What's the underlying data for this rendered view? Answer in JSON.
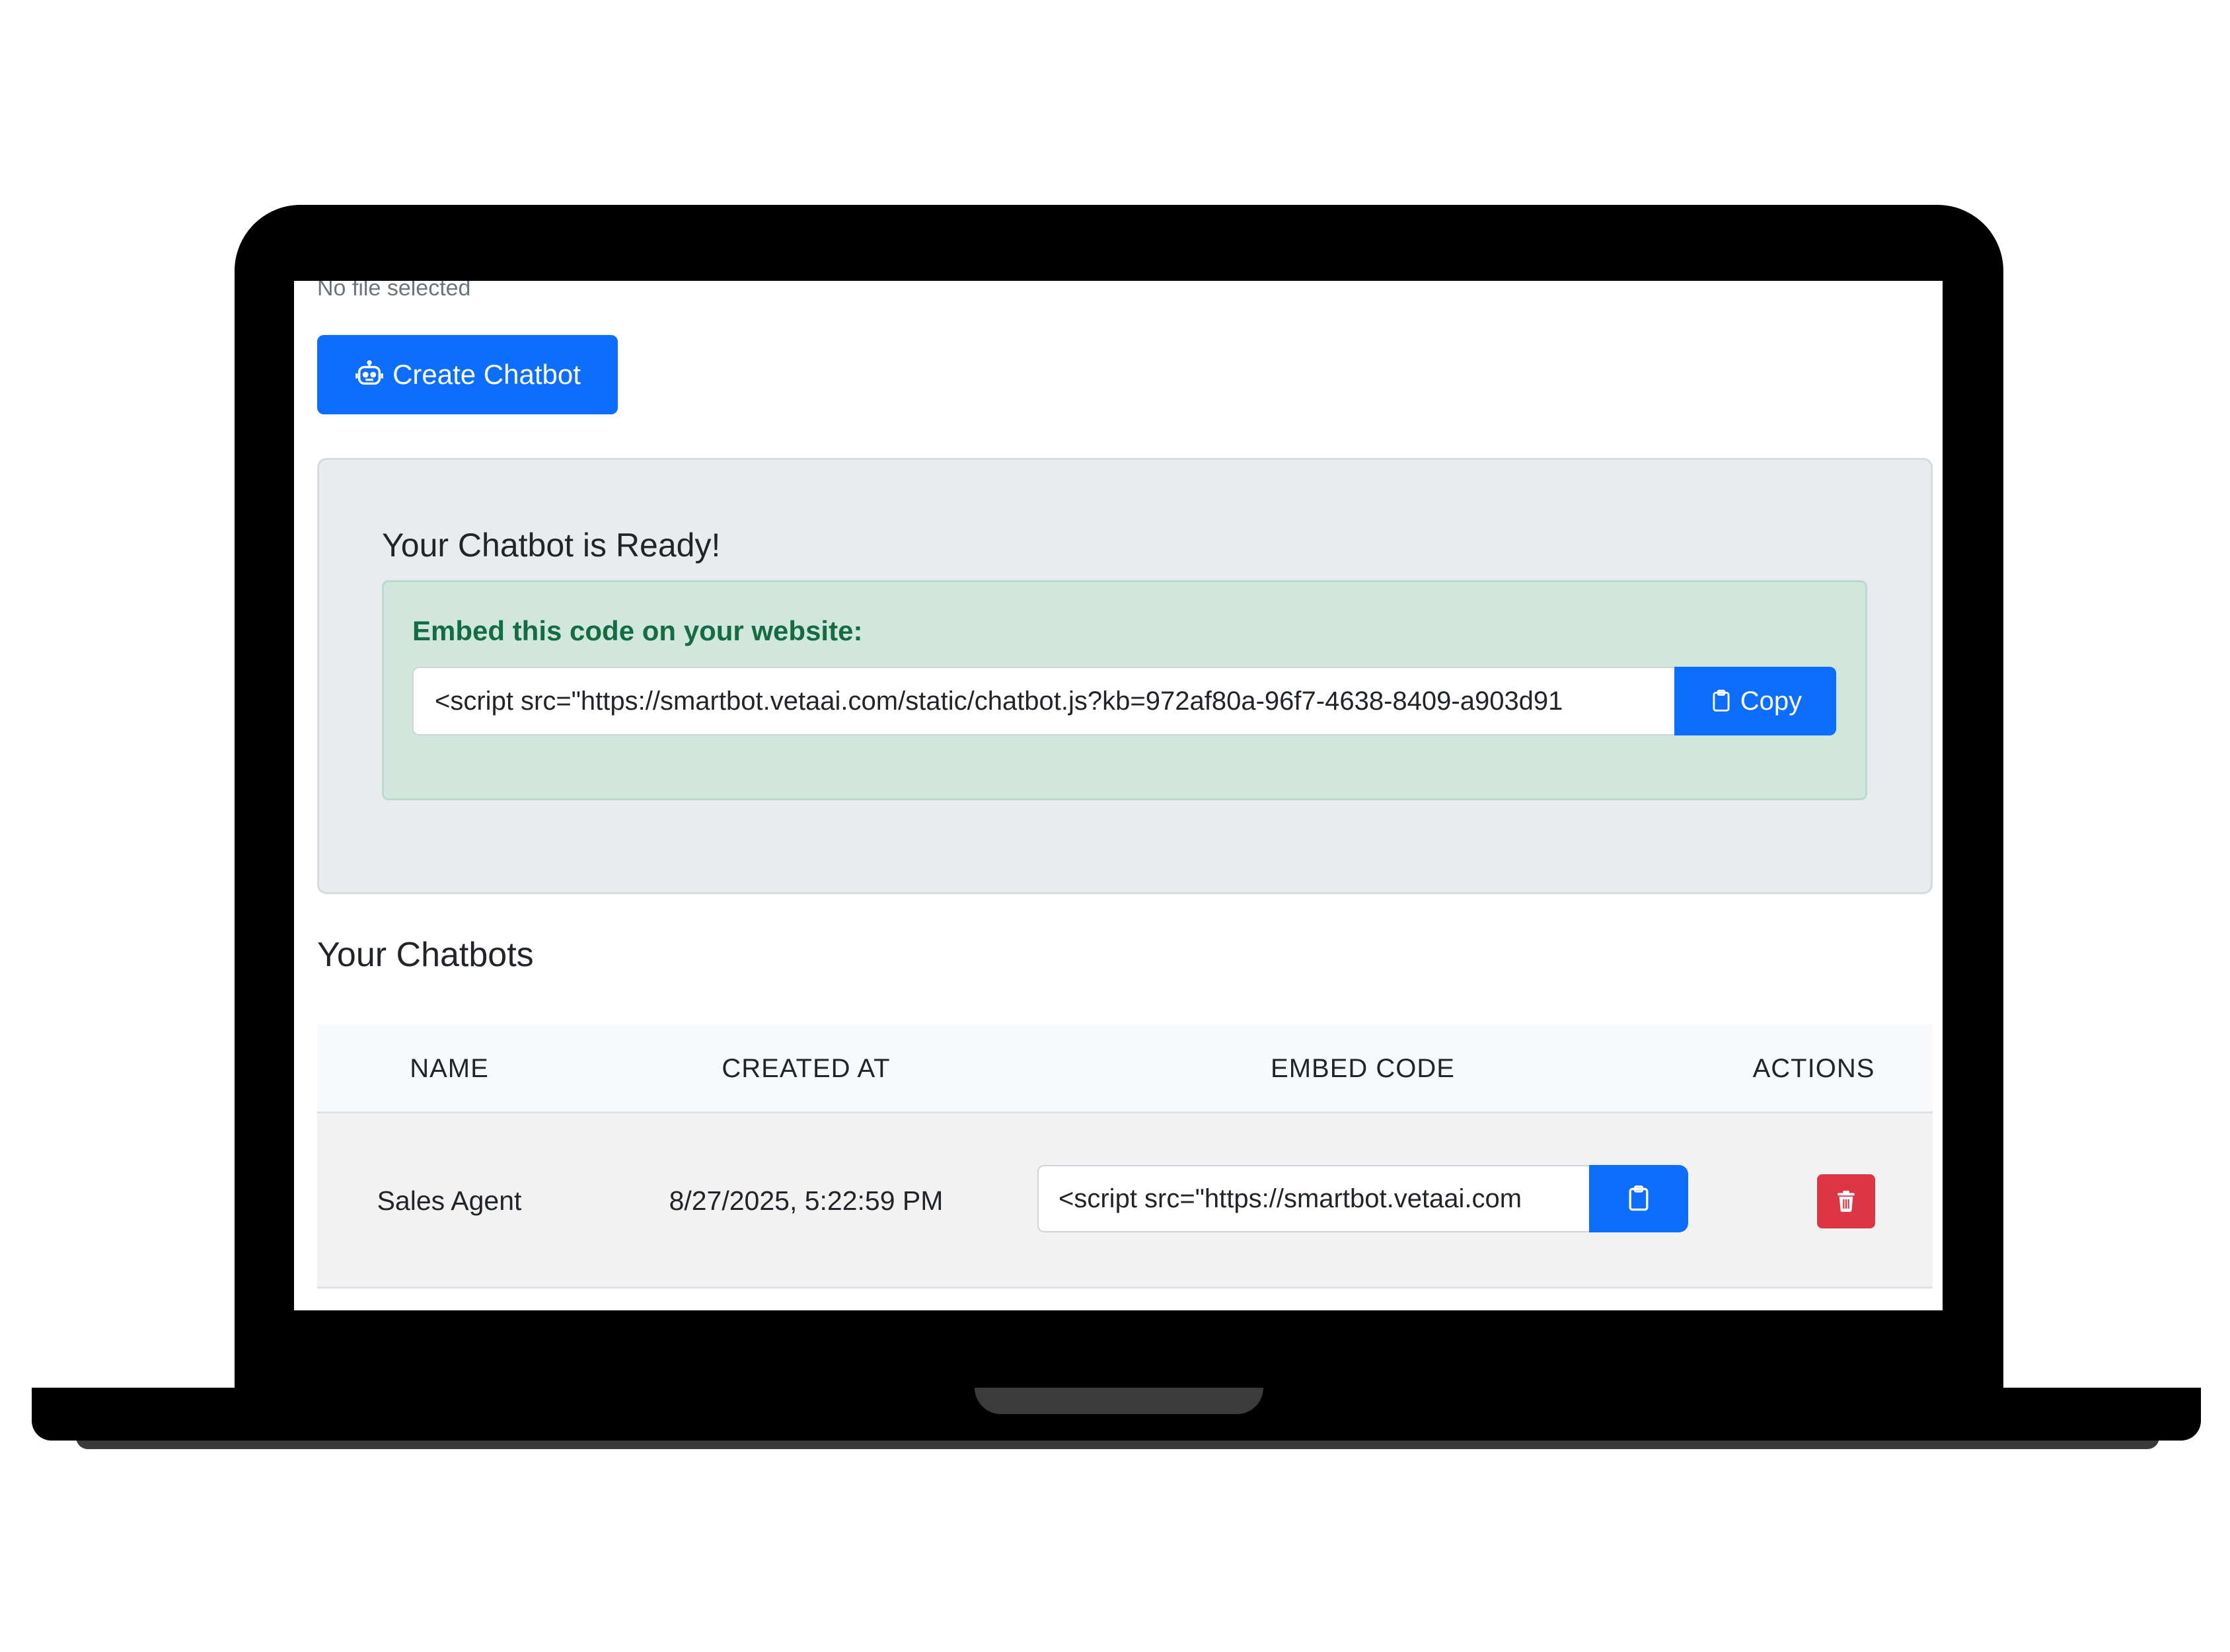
{
  "upload": {
    "file_status": "No file selected"
  },
  "create_button": {
    "label": "Create Chatbot",
    "icon": "robot-icon"
  },
  "ready_card": {
    "title": "Your Chatbot is Ready!",
    "embed_label": "Embed this code on your website:",
    "embed_code": "<script src=\"https://smartbot.vetaai.com/static/chatbot.js?kb=972af80a-96f7-4638-8409-a903d91",
    "copy_label": "Copy",
    "copy_icon": "clipboard-icon"
  },
  "chatbots": {
    "title": "Your Chatbots",
    "columns": [
      "NAME",
      "CREATED AT",
      "EMBED CODE",
      "ACTIONS"
    ],
    "rows": [
      {
        "name": "Sales Agent",
        "created_at": "8/27/2025, 5:22:59 PM",
        "embed_code": "<script src=\"https://smartbot.vetaai.com",
        "copy_icon": "clipboard-icon",
        "delete_icon": "trash-icon"
      }
    ]
  },
  "colors": {
    "primary": "#0d6efd",
    "danger": "#dc3545",
    "success_text": "#146c43",
    "success_bg": "#d1e7dd",
    "card_bg": "#e9ecef"
  }
}
